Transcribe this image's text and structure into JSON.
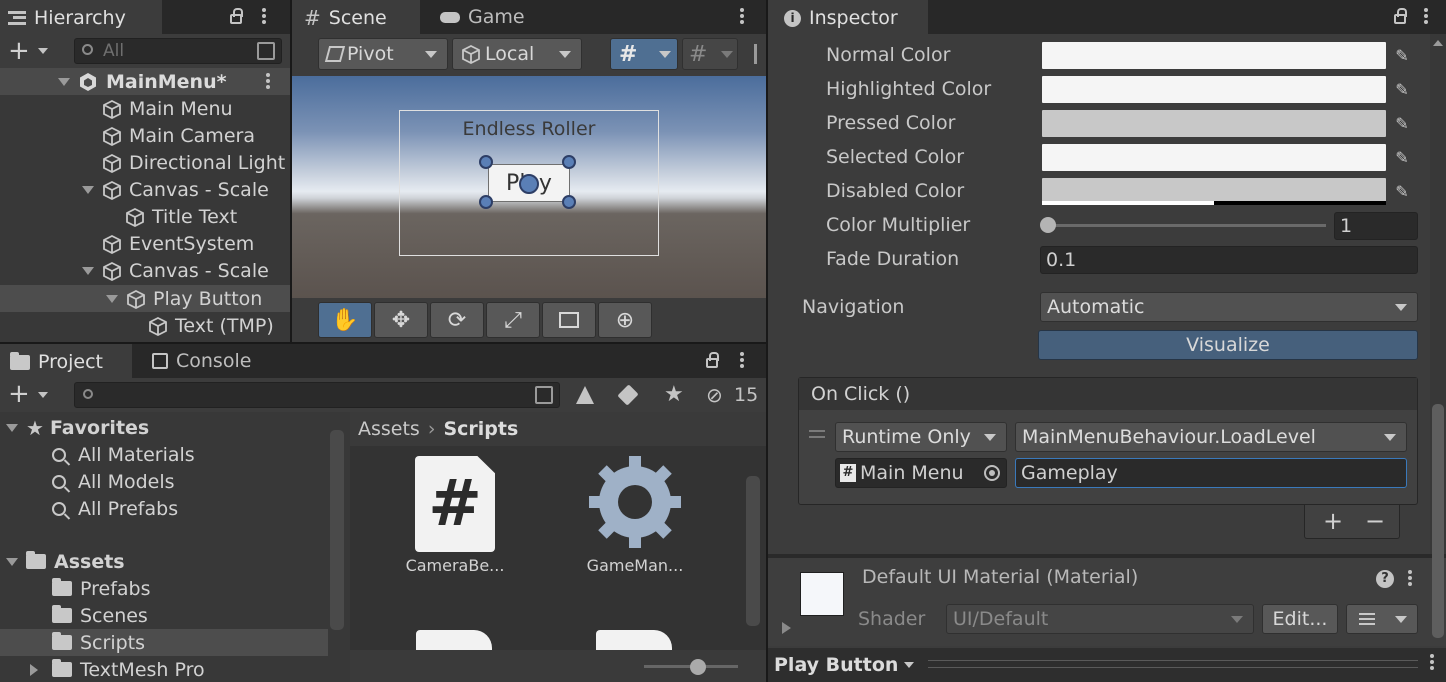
{
  "hierarchy": {
    "tab_label": "Hierarchy",
    "search_placeholder": "All",
    "items": [
      {
        "label": "MainMenu*"
      },
      {
        "label": "Main Menu"
      },
      {
        "label": "Main Camera"
      },
      {
        "label": "Directional Light"
      },
      {
        "label": "Canvas - Scale"
      },
      {
        "label": "Title Text"
      },
      {
        "label": "EventSystem"
      },
      {
        "label": "Canvas - Scale"
      },
      {
        "label": "Play Button"
      },
      {
        "label": "Text (TMP)"
      }
    ]
  },
  "scene": {
    "tabs": [
      {
        "label": "Scene"
      },
      {
        "label": "Game"
      }
    ],
    "pivot_label": "Pivot",
    "local_label": "Local",
    "title_text": "Endless Roller",
    "button_text": "Play"
  },
  "project": {
    "tabs": [
      {
        "label": "Project"
      },
      {
        "label": "Console"
      }
    ],
    "hidden_count": "15",
    "favorites_label": "Favorites",
    "favorites": [
      {
        "label": "All Materials"
      },
      {
        "label": "All Models"
      },
      {
        "label": "All Prefabs"
      }
    ],
    "assets_label": "Assets",
    "assets": [
      {
        "label": "Prefabs"
      },
      {
        "label": "Scenes"
      },
      {
        "label": "Scripts"
      },
      {
        "label": "TextMesh Pro"
      }
    ],
    "breadcrumb": [
      "Assets",
      "Scripts"
    ],
    "files": [
      {
        "label": "CameraBe..."
      },
      {
        "label": "GameMan..."
      }
    ],
    "hash_symbol": "#"
  },
  "inspector": {
    "tab_label": "Inspector",
    "colors": [
      {
        "label": "Normal Color",
        "color": "#f5f5f5"
      },
      {
        "label": "Highlighted Color",
        "color": "#f5f5f5"
      },
      {
        "label": "Pressed Color",
        "color": "#c8c8c8"
      },
      {
        "label": "Selected Color",
        "color": "#f5f5f5"
      },
      {
        "label": "Disabled Color",
        "color": "#c8c8c8"
      }
    ],
    "color_multiplier_label": "Color Multiplier",
    "color_multiplier_value": "1",
    "color_multiplier_fraction": 0.0,
    "fade_duration_label": "Fade Duration",
    "fade_duration_value": "0.1",
    "navigation_label": "Navigation",
    "navigation_value": "Automatic",
    "visualize_label": "Visualize",
    "onclick_header": "On Click ()",
    "runtime_value": "Runtime Only",
    "function_value": "MainMenuBehaviour.LoadLevel",
    "object_value": "Main Menu",
    "argument_value": "Gameplay",
    "plus_label": "+",
    "minus_label": "−",
    "material_name": "Default UI Material (Material)",
    "shader_label": "Shader",
    "shader_value": "UI/Default",
    "edit_label": "Edit...",
    "help_label": "?",
    "preview_label": "Play Button"
  },
  "colors": {
    "accent_blue": "#46607c",
    "visualize_bg": "#46607c",
    "field_focus": "#3a79bb"
  }
}
